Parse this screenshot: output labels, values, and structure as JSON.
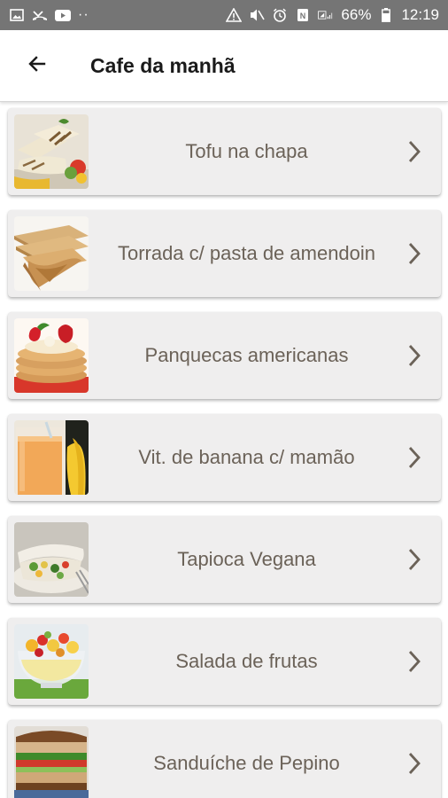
{
  "status_bar": {
    "battery": "66%",
    "time": "12:19",
    "left_icons": [
      "image-icon",
      "missed-call-icon",
      "youtube-icon",
      "more-dots-icon"
    ],
    "right_icons": [
      "warning-icon",
      "mute-icon",
      "alarm-icon",
      "nfc-icon",
      "signal-icon",
      "battery-icon"
    ]
  },
  "app_bar": {
    "back_icon": "arrow-back-icon",
    "title": "Cafe da manhã"
  },
  "menu_items": [
    {
      "label": "Tofu na chapa",
      "image": "tofu-photo"
    },
    {
      "label": "Torrada c/ pasta de amendoin",
      "image": "toast-photo"
    },
    {
      "label": "Panquecas americanas",
      "image": "pancakes-photo"
    },
    {
      "label": "Vit. de banana c/ mamão",
      "image": "smoothie-photo"
    },
    {
      "label": "Tapioca Vegana",
      "image": "tapioca-photo"
    },
    {
      "label": "Salada de frutas",
      "image": "fruit-salad-photo"
    },
    {
      "label": "Sanduíche de Pepino",
      "image": "sandwich-photo"
    }
  ],
  "colors": {
    "status_bar": "#757575",
    "card_bg": "#efeeee",
    "label_text": "#6b6258",
    "chevron": "#6b6258"
  }
}
